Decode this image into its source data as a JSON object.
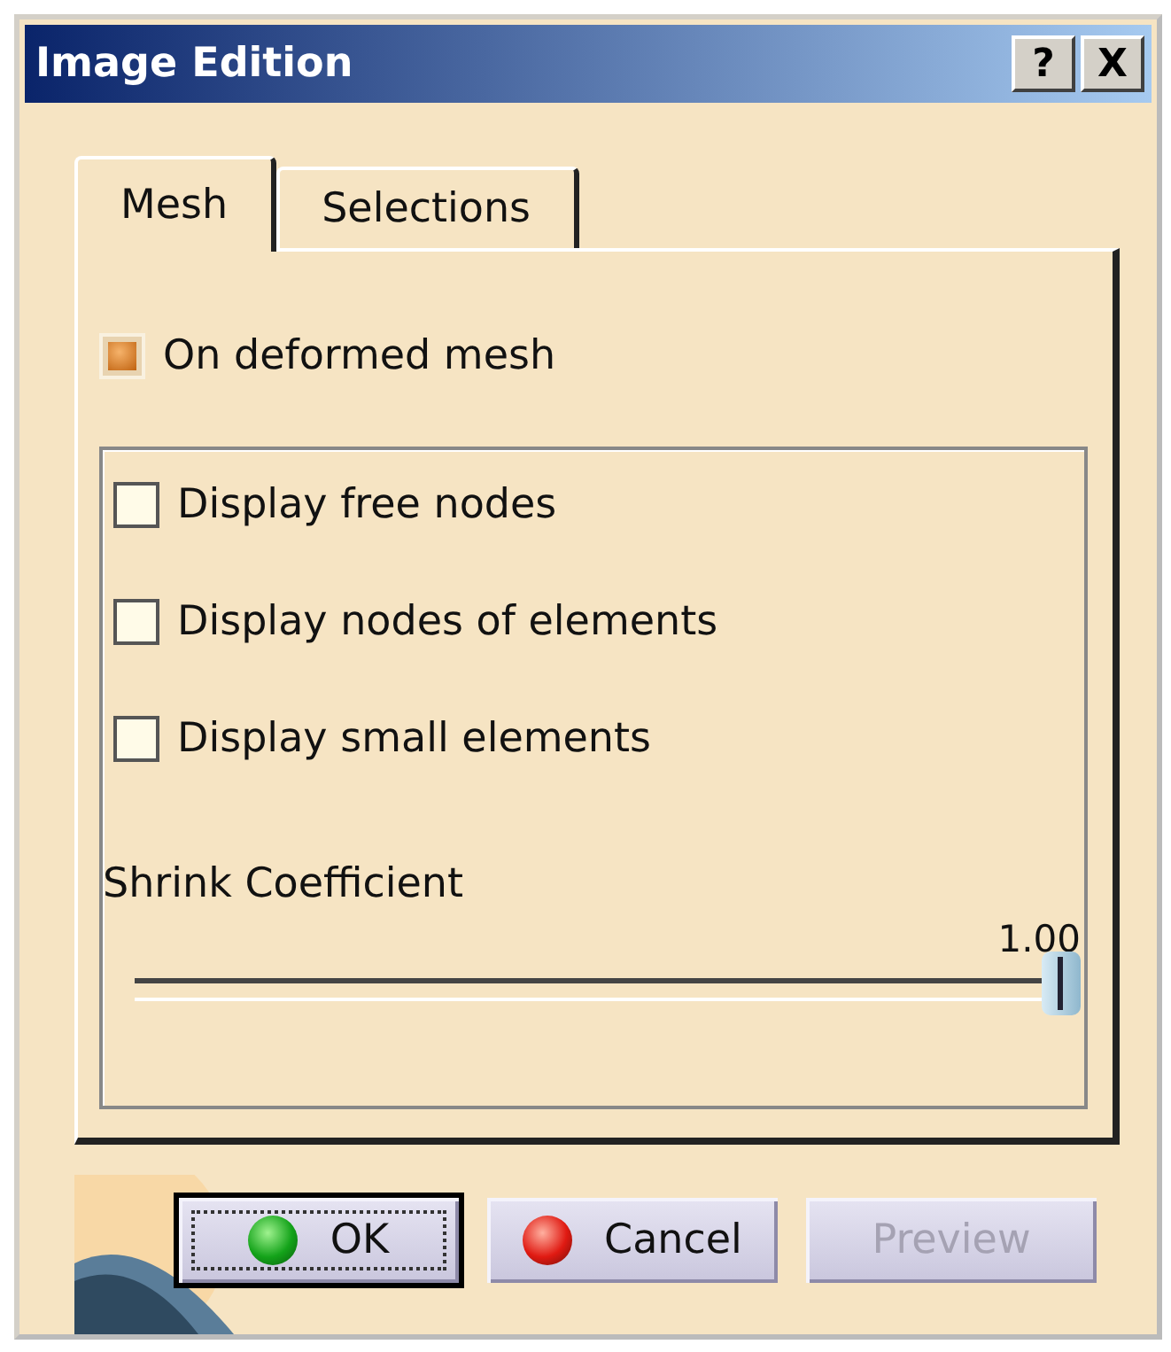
{
  "window": {
    "title": "Image Edition",
    "title_buttons": [
      "?",
      "X"
    ]
  },
  "tabs": [
    {
      "label": "Mesh",
      "selected": true
    },
    {
      "label": "Selections",
      "selected": false
    }
  ],
  "deformed_mesh": {
    "label": "On deformed mesh",
    "checked": true
  },
  "options": [
    {
      "label": "Display free nodes",
      "checked": false
    },
    {
      "label": "Display nodes of elements",
      "checked": false
    },
    {
      "label": "Display small elements",
      "checked": false
    }
  ],
  "shrink": {
    "label": "Shrink Coefficient",
    "reading": "1.00",
    "level": 1
  },
  "buttons": [
    {
      "label": "OK",
      "kind": "ok",
      "default": true,
      "disabled": false
    },
    {
      "label": "Cancel",
      "kind": "cancel",
      "default": false,
      "disabled": false
    },
    {
      "label": "Preview",
      "kind": "plain",
      "default": false,
      "disabled": true
    }
  ]
}
